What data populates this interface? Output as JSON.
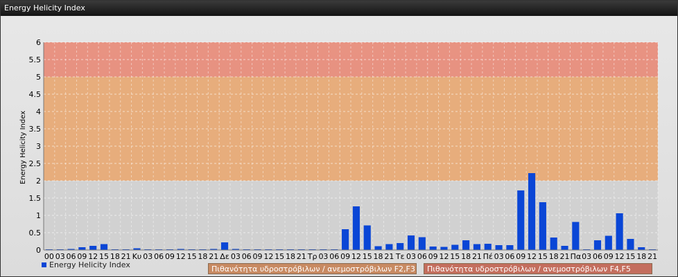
{
  "window": {
    "title": "Energy Helicity Index"
  },
  "colors": {
    "bar": "#0a46d6",
    "band_low": "#cfcfcf",
    "band_mid": "#e8a36a",
    "band_high": "#e88470",
    "legend_mid_bg": "#c88a62",
    "legend_high_bg": "#c46e5e"
  },
  "chart_data": {
    "type": "bar",
    "ylabel": "Energy Helicity Index",
    "ylim": [
      0,
      6
    ],
    "yticks": [
      "0",
      "0.5",
      "1",
      "1.5",
      "2",
      "2.5",
      "3",
      "3.5",
      "4",
      "4.5",
      "5",
      "5.5",
      "6"
    ],
    "grid": true,
    "legend_placement": "bottom-left",
    "categories": [
      "00",
      "03",
      "06",
      "09",
      "12",
      "15",
      "18",
      "21",
      "Κυ",
      "03",
      "06",
      "09",
      "12",
      "15",
      "18",
      "21",
      "Δε",
      "03",
      "06",
      "09",
      "12",
      "15",
      "18",
      "21",
      "Τρ",
      "03",
      "06",
      "09",
      "12",
      "15",
      "18",
      "21",
      "Τε",
      "03",
      "06",
      "09",
      "12",
      "15",
      "18",
      "21",
      "Πέ",
      "03",
      "06",
      "09",
      "12",
      "15",
      "18",
      "21",
      "Πα",
      "03",
      "06",
      "09",
      "12",
      "15",
      "18",
      "21"
    ],
    "series": [
      {
        "name": "Energy Helicity Index",
        "values": [
          0.02,
          0.02,
          0.03,
          0.08,
          0.12,
          0.17,
          0.02,
          0.02,
          0.05,
          0.02,
          0.02,
          0.02,
          0.03,
          0.02,
          0.02,
          0.03,
          0.22,
          0.03,
          0.02,
          0.02,
          0.02,
          0.02,
          0.02,
          0.02,
          0.02,
          0.02,
          0.02,
          0.6,
          1.26,
          0.71,
          0.11,
          0.17,
          0.2,
          0.42,
          0.37,
          0.1,
          0.09,
          0.15,
          0.28,
          0.17,
          0.18,
          0.14,
          0.14,
          1.72,
          2.22,
          1.38,
          0.36,
          0.12,
          0.81,
          0.02,
          0.28,
          0.41,
          1.06,
          0.32,
          0.08,
          0.02
        ]
      }
    ],
    "bands": [
      {
        "from": 0,
        "to": 2,
        "color_key": "band_low"
      },
      {
        "from": 2,
        "to": 5,
        "color_key": "band_mid",
        "label": "Πιθανότητα υδροστρόβιλων / ανεμοστρόβιλων F2,F3"
      },
      {
        "from": 5,
        "to": 6,
        "color_key": "band_high",
        "label": "Πιθανότητα υδροστρόβιλων / ανεμοστρόβιλων F4,F5"
      }
    ]
  }
}
